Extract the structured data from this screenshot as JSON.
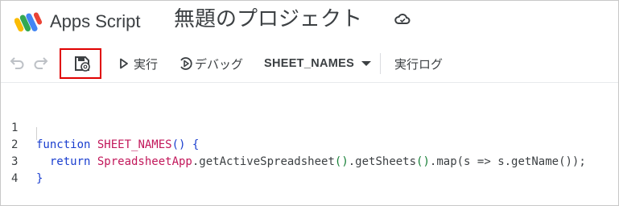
{
  "header": {
    "app_name": "Apps Script",
    "project_title": "無題のプロジェクト"
  },
  "toolbar": {
    "run_label": "実行",
    "debug_label": "デバッグ",
    "function_name": "SHEET_NAMES",
    "log_label": "実行ログ"
  },
  "editor": {
    "lines": [
      {
        "number": "1",
        "tokens": [
          "function",
          " ",
          "SHEET_NAMES",
          "() {"
        ]
      },
      {
        "number": "2",
        "tokens": [
          "  return ",
          "SpreadsheetApp",
          ".getActiveSpreadsheet",
          "()",
          ".getSheets",
          "()",
          ".map(s => s.getName",
          "());"
        ]
      },
      {
        "number": "3",
        "tokens": [
          "}"
        ]
      },
      {
        "number": "4",
        "tokens": []
      }
    ]
  },
  "colors": {
    "keyword": "#1a3ecf",
    "function_name": "#c2185b",
    "highlight_box": "#e00000"
  },
  "icons": [
    "apps-script-logo",
    "cloud-sync-icon",
    "undo-icon",
    "redo-icon",
    "save-icon",
    "play-icon",
    "debug-icon",
    "dropdown-caret-icon"
  ]
}
